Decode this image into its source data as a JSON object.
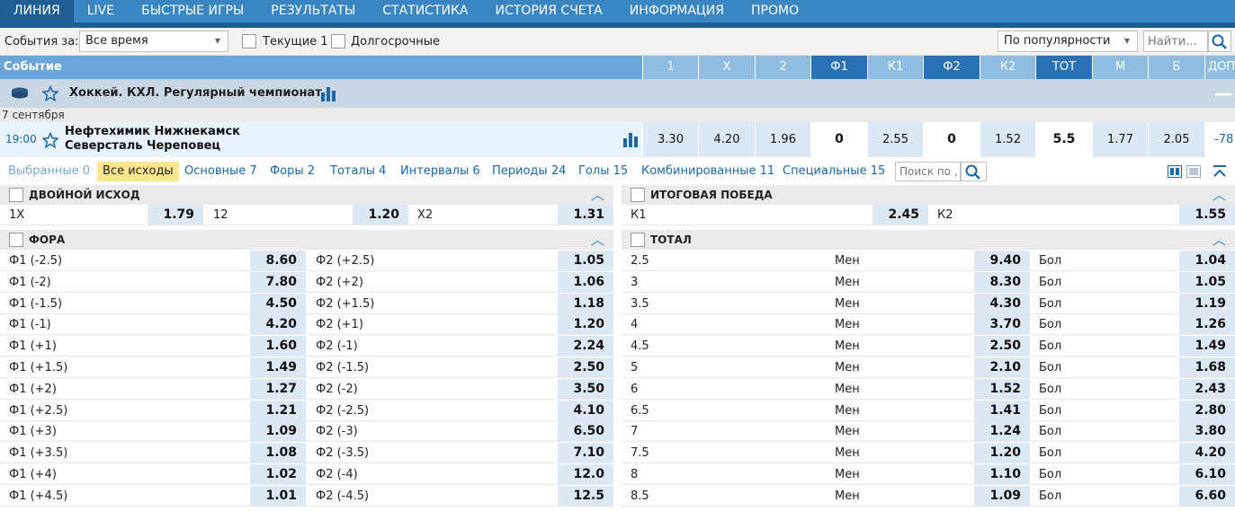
{
  "topnav": [
    "ЛИНИЯ",
    "LIVE",
    "БЫСТРЫЕ ИГРЫ",
    "РЕЗУЛЬТАТЫ",
    "СТАТИСТИКА",
    "ИСТОРИЯ СЧЕТА",
    "ИНФОРМАЦИЯ",
    "ПРОМО"
  ],
  "filters": {
    "events_for_label": "События за:",
    "period_value": "Все время",
    "current_label": "Текущие 1",
    "longterm_label": "Долгосрочные",
    "sort_value": "По популярности",
    "search_placeholder": "Найти..."
  },
  "columns": {
    "event_label": "Событие",
    "headers": [
      "1",
      "X",
      "2",
      "Ф1",
      "К1",
      "Ф2",
      "К2",
      "ТОТ",
      "М",
      "Б",
      "ДОП"
    ]
  },
  "league": {
    "title": "Хоккей. КХЛ. Регулярный чемпионат."
  },
  "date": "7 сентября",
  "event": {
    "time": "19:00",
    "team1": "Нефтехимик Нижнекамск",
    "team2": "Северсталь Череповец",
    "odds": [
      "3.30",
      "4.20",
      "1.96",
      "0",
      "2.55",
      "0",
      "1.52",
      "5.5",
      "1.77",
      "2.05",
      "-78"
    ]
  },
  "tabs": [
    "Выбранные 0",
    "Все исходы",
    "Основные 7",
    "Форы 2",
    "Тоталы 4",
    "Интервалы 6",
    "Периоды 24",
    "Голы 15",
    "Комбинированные 11",
    "Специальные 15"
  ],
  "tab_search_placeholder": "Поиск по ,",
  "double_chance": {
    "title": "ДВОЙНОЙ ИСХОД",
    "items": [
      {
        "label": "1X",
        "odd": "1.79"
      },
      {
        "label": "12",
        "odd": "1.20"
      },
      {
        "label": "X2",
        "odd": "1.31"
      }
    ]
  },
  "winner": {
    "title": "ИТОГОВАЯ ПОБЕДА",
    "items": [
      {
        "label": "К1",
        "odd": "2.45"
      },
      {
        "label": "К2",
        "odd": "1.55"
      }
    ]
  },
  "handicap": {
    "title": "ФОРА",
    "rows": [
      {
        "l1": "Ф1 (-2.5)",
        "o1": "8.60",
        "l2": "Ф2 (+2.5)",
        "o2": "1.05"
      },
      {
        "l1": "Ф1 (-2)",
        "o1": "7.80",
        "l2": "Ф2 (+2)",
        "o2": "1.06"
      },
      {
        "l1": "Ф1 (-1.5)",
        "o1": "4.50",
        "l2": "Ф2 (+1.5)",
        "o2": "1.18"
      },
      {
        "l1": "Ф1 (-1)",
        "o1": "4.20",
        "l2": "Ф2 (+1)",
        "o2": "1.20"
      },
      {
        "l1": "Ф1 (+1)",
        "o1": "1.60",
        "l2": "Ф2 (-1)",
        "o2": "2.24"
      },
      {
        "l1": "Ф1 (+1.5)",
        "o1": "1.49",
        "l2": "Ф2 (-1.5)",
        "o2": "2.50"
      },
      {
        "l1": "Ф1 (+2)",
        "o1": "1.27",
        "l2": "Ф2 (-2)",
        "o2": "3.50"
      },
      {
        "l1": "Ф1 (+2.5)",
        "o1": "1.21",
        "l2": "Ф2 (-2.5)",
        "o2": "4.10"
      },
      {
        "l1": "Ф1 (+3)",
        "o1": "1.09",
        "l2": "Ф2 (-3)",
        "o2": "6.50"
      },
      {
        "l1": "Ф1 (+3.5)",
        "o1": "1.08",
        "l2": "Ф2 (-3.5)",
        "o2": "7.10"
      },
      {
        "l1": "Ф1 (+4)",
        "o1": "1.02",
        "l2": "Ф2 (-4)",
        "o2": "12.0"
      },
      {
        "l1": "Ф1 (+4.5)",
        "o1": "1.01",
        "l2": "Ф2 (-4.5)",
        "o2": "12.5"
      }
    ]
  },
  "total": {
    "title": "ТОТАЛ",
    "under_label": "Мен",
    "over_label": "Бол",
    "rows": [
      {
        "t": "2.5",
        "u": "9.40",
        "o": "1.04"
      },
      {
        "t": "3",
        "u": "8.30",
        "o": "1.05"
      },
      {
        "t": "3.5",
        "u": "4.30",
        "o": "1.19"
      },
      {
        "t": "4",
        "u": "3.70",
        "o": "1.26"
      },
      {
        "t": "4.5",
        "u": "2.50",
        "o": "1.49"
      },
      {
        "t": "5",
        "u": "2.10",
        "o": "1.68"
      },
      {
        "t": "6",
        "u": "1.52",
        "o": "2.43"
      },
      {
        "t": "6.5",
        "u": "1.41",
        "o": "2.80"
      },
      {
        "t": "7",
        "u": "1.24",
        "o": "3.80"
      },
      {
        "t": "7.5",
        "u": "1.20",
        "o": "4.20"
      },
      {
        "t": "8",
        "u": "1.10",
        "o": "6.10"
      },
      {
        "t": "8.5",
        "u": "1.09",
        "o": "6.60"
      }
    ]
  },
  "colors": {
    "nav": "#3a86c2",
    "nav_active": "#1f5e94",
    "header_light": "#8fbde1",
    "header_dark": "#2a72b5",
    "odd_cell": "#dce9f4",
    "active_tab": "#fde78c"
  }
}
